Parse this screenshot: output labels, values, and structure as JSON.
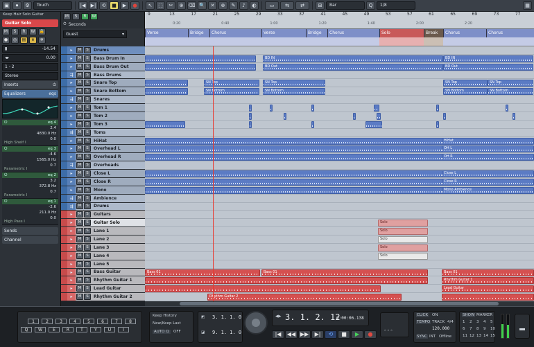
{
  "toolbar": {
    "mode_combo": "Touch",
    "grid_combo": "Bar",
    "quant_combo": "1/8"
  },
  "inspector": {
    "title": "Keep Hair Solo Guitar",
    "track_name": "Guitar Solo",
    "volume": "-14.54",
    "pan": "0.00",
    "routing_in": "1 - 2",
    "routing_out": "Stereo",
    "sections": {
      "inserts": "Inserts",
      "equalizers": "Equalizers",
      "eqs_label": "eqs",
      "sends": "Sends",
      "channel": "Channel"
    },
    "eq_bands": [
      {
        "label": "eq 4",
        "gain": "2.4",
        "freq": "4830.0 Hz",
        "q": "0.0",
        "type": "High Shelf I"
      },
      {
        "label": "eq 3",
        "gain": "-4.6",
        "freq": "1565.0 Hz",
        "q": "0.7",
        "type": "Parametric I"
      },
      {
        "label": "eq 2",
        "gain": "3.2",
        "freq": "372.8 Hz",
        "q": "0.7",
        "type": "Parametric I"
      },
      {
        "label": "eq 1",
        "gain": "-2.6",
        "freq": "211.0 Hz",
        "q": "0.0",
        "type": "High Pass I"
      }
    ]
  },
  "tracklist": {
    "header_label": "Seconds",
    "preset_label": "Guest",
    "tracks": [
      {
        "name": "Drums",
        "kind": "folder"
      },
      {
        "name": "Bass Drum In",
        "kind": "audio"
      },
      {
        "name": "Bass Drum Out",
        "kind": "audio"
      },
      {
        "name": "Bass Drums",
        "kind": "group"
      },
      {
        "name": "Snare Top",
        "kind": "audio"
      },
      {
        "name": "Snare Bottom",
        "kind": "audio"
      },
      {
        "name": "Snares",
        "kind": "group"
      },
      {
        "name": "Tom 1",
        "kind": "audio"
      },
      {
        "name": "Tom 2",
        "kind": "audio"
      },
      {
        "name": "Tom 3",
        "kind": "audio"
      },
      {
        "name": "Toms",
        "kind": "group"
      },
      {
        "name": "HiHat",
        "kind": "audio"
      },
      {
        "name": "Overhead L",
        "kind": "audio"
      },
      {
        "name": "Overhead R",
        "kind": "audio"
      },
      {
        "name": "Overheads",
        "kind": "group"
      },
      {
        "name": "Close L",
        "kind": "audio"
      },
      {
        "name": "Close R",
        "kind": "audio"
      },
      {
        "name": "Mono",
        "kind": "audio"
      },
      {
        "name": "Ambience",
        "kind": "group"
      },
      {
        "name": "Drums",
        "kind": "group"
      },
      {
        "name": "Guitars",
        "kind": "redfolder"
      },
      {
        "name": "Guitar Solo",
        "kind": "sel"
      },
      {
        "name": "Lane 1",
        "kind": "red"
      },
      {
        "name": "Lane 2",
        "kind": "red"
      },
      {
        "name": "Lane 3",
        "kind": "red"
      },
      {
        "name": "Lane 4",
        "kind": "red"
      },
      {
        "name": "Lane 5",
        "kind": "red"
      },
      {
        "name": "Bass Guitar",
        "kind": "red"
      },
      {
        "name": "Rhythm Guitar 1",
        "kind": "red"
      },
      {
        "name": "Lead Guitar",
        "kind": "red"
      },
      {
        "name": "Rhythm Guitar 2",
        "kind": "red"
      }
    ]
  },
  "ruler": {
    "bars": [
      "9",
      "13",
      "17",
      "21",
      "25",
      "29",
      "33",
      "37",
      "41",
      "45",
      "49",
      "53",
      "57",
      "61",
      "65",
      "69",
      "73",
      "77"
    ],
    "times": [
      "0:20",
      "0:40",
      "1:00",
      "1:20",
      "1:40",
      "2:00",
      "2:20"
    ]
  },
  "markers": [
    {
      "label": "Verse",
      "kind": "normal"
    },
    {
      "label": "Bridge",
      "kind": "normal"
    },
    {
      "label": "Chorus",
      "kind": "normal"
    },
    {
      "label": "Verse",
      "kind": "normal"
    },
    {
      "label": "Bridge",
      "kind": "normal"
    },
    {
      "label": "Chorus",
      "kind": "normal"
    },
    {
      "label": "Solo",
      "kind": "solo"
    },
    {
      "label": "Break",
      "kind": "brk"
    },
    {
      "label": "Chorus",
      "kind": "normal"
    },
    {
      "label": "Chorus",
      "kind": "normal"
    }
  ],
  "event_labels": {
    "bd_in": "BD IN",
    "bd_out": "BD Out",
    "sn_top": "SN Top",
    "sn_bottom": "SN Bottom",
    "hihat": "HiHat",
    "oh_l": "OH L",
    "oh_r": "OH R",
    "close_l": "Close L",
    "close_r": "Close R",
    "mono": "Mono Ambience",
    "solo": "Solo",
    "bass": "Bass 01",
    "rhythm1": "Rhythm Guitar 1",
    "lead": "Lead Guitar",
    "rhythm2": "Rhythm Guitar 2"
  },
  "transport": {
    "keys_row1": [
      "1",
      "2",
      "3",
      "4",
      "5",
      "6",
      "7",
      "8"
    ],
    "keys_row2": [
      "Q",
      "W",
      "E",
      "R",
      "T",
      "Y",
      "U",
      "I"
    ],
    "keep_history": "Keep History",
    "new_keep_last": "New/Keep Last",
    "auto_q": "AUTO Q",
    "auto_q_state": "OFF",
    "left_locator": "3. 1. 1. 0",
    "right_locator": "9. 1. 1. 0",
    "position": "3. 1. 2. 12",
    "time": "0:00:06.138",
    "click": "CLICK",
    "click_state": "ON",
    "tempo": "TEMPO",
    "track_mode": "TRACK",
    "signature": "4/4",
    "tempo_value": "120.000",
    "sync": "SYNC",
    "sync_int": "INT",
    "sync_offline": "Offline",
    "show": "SHOW",
    "marker_label": "MARKER",
    "marker_nums": [
      "1",
      "2",
      "3",
      "4",
      "5",
      "6",
      "7",
      "8",
      "9",
      "10",
      "11",
      "12",
      "13",
      "14",
      "15"
    ]
  }
}
